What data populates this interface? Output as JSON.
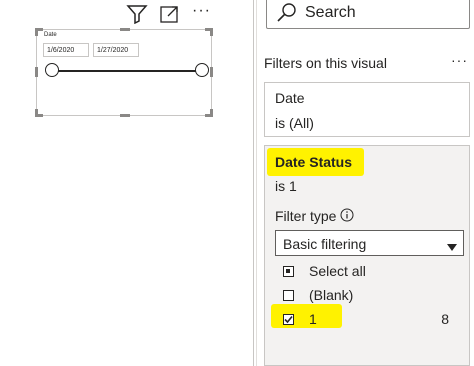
{
  "visual": {
    "slicer_title": "Date",
    "start_date": "1/6/2020",
    "end_date": "1/27/2020",
    "slider_start_fraction": 0,
    "slider_end_fraction": 1,
    "header_icons": [
      "filter-icon",
      "focus-mode-icon",
      "more-options-icon"
    ],
    "more_label": "···"
  },
  "filters_pane": {
    "search": {
      "placeholder": "Search",
      "icon": "search-icon"
    },
    "section_title": "Filters on this visual",
    "section_more": "···",
    "cards": [
      {
        "name": "Date",
        "state": "is (All)"
      },
      {
        "name": "Date Status",
        "state": "is 1",
        "filter_type_label": "Filter type",
        "filter_type_value": "Basic filtering",
        "options": [
          {
            "label": "Select all",
            "state": "partial",
            "count": ""
          },
          {
            "label": "(Blank)",
            "state": "unchecked",
            "count": ""
          },
          {
            "label": "1",
            "state": "checked",
            "count": "8"
          }
        ]
      }
    ],
    "highlight_color": "#fff200"
  }
}
